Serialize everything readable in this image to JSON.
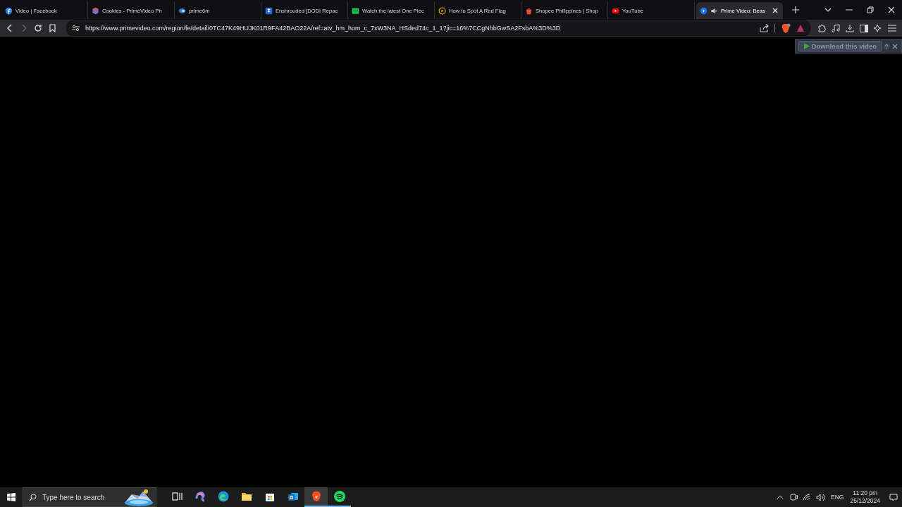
{
  "tabs": [
    {
      "title": "Video | Facebook",
      "selected": false,
      "audio": false
    },
    {
      "title": "Cookies - PrimeVideo Ph",
      "selected": false,
      "audio": false
    },
    {
      "title": "prime6m",
      "selected": false,
      "audio": false
    },
    {
      "title": "Enshrouded [DODI Repac",
      "selected": false,
      "audio": false
    },
    {
      "title": "Watch the latest One Piec",
      "selected": false,
      "audio": false
    },
    {
      "title": "How to Spot A Red Flag",
      "selected": false,
      "audio": false
    },
    {
      "title": "Shopee Philippines | Shop",
      "selected": false,
      "audio": false
    },
    {
      "title": "YouTube",
      "selected": false,
      "audio": false
    },
    {
      "title": "Prime Video: Beas",
      "selected": true,
      "audio": true
    }
  ],
  "address_bar": {
    "url": "https://www.primevideo.com/region/fe/detail/0TC47K49HUJK01R9FA42BAO22A/ref=atv_hm_hom_c_7xW3NA_HSded74c_1_1?jic=16%7CCgNhbGwSA2FsbA%3D%3D"
  },
  "download_overlay": {
    "label": "Download this video"
  },
  "taskbar": {
    "search": {
      "placeholder": "Type here to search"
    },
    "apps": [
      {
        "selected": false,
        "running": false
      },
      {
        "selected": false,
        "running": false
      },
      {
        "selected": false,
        "running": false
      },
      {
        "selected": false,
        "running": false
      },
      {
        "selected": false,
        "running": false
      },
      {
        "selected": false,
        "running": false
      },
      {
        "selected": true,
        "running": true
      },
      {
        "selected": false,
        "running": true
      }
    ],
    "language": "ENG",
    "time": "11:20 pm",
    "date": "25/12/2024"
  }
}
